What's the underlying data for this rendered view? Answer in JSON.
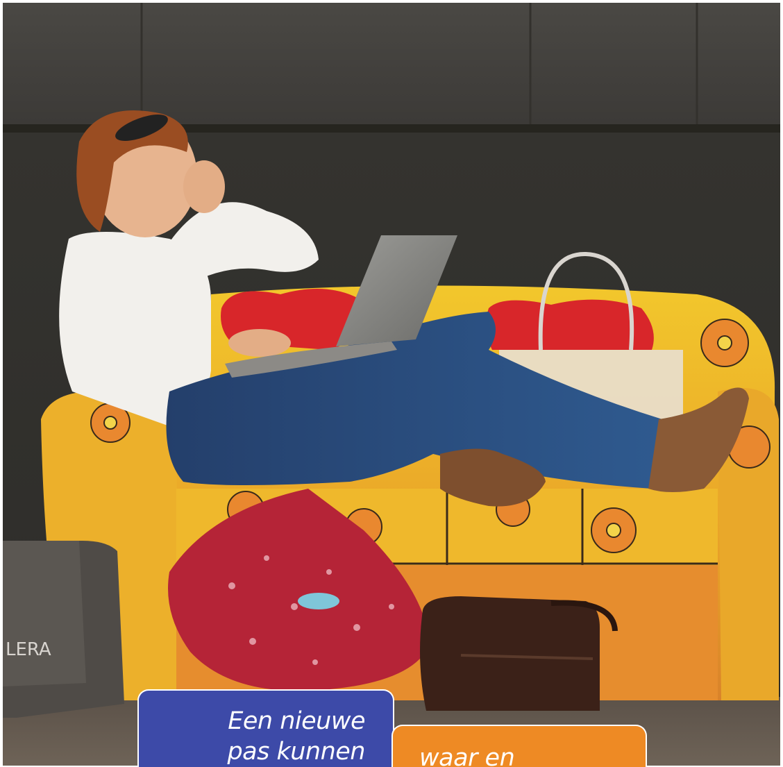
{
  "photo": {
    "alt_subject": "woman-on-sofa-with-laptop",
    "bag_brand_text": "LERA"
  },
  "tiles": {
    "blue": {
      "line1": "Een nieuwe",
      "line2": "pas kunnen",
      "color": "#3d4aa8"
    },
    "orange": {
      "line1": "waar en",
      "color": "#ee8a24"
    }
  }
}
